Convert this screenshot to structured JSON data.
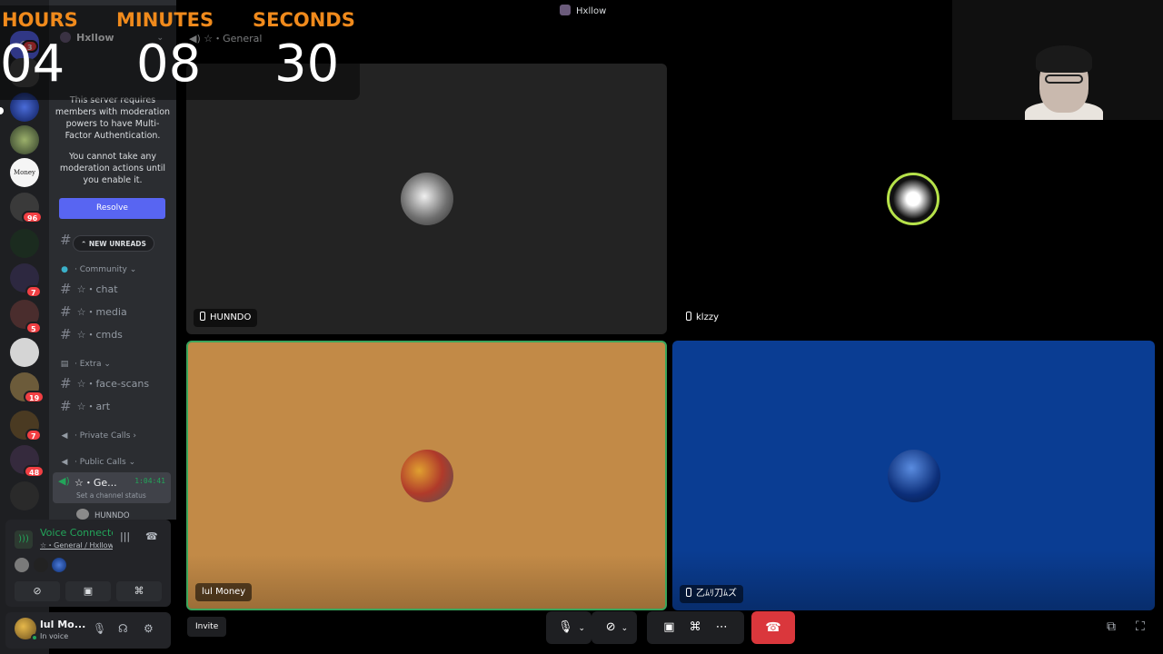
{
  "window": {
    "title": "Hxllow"
  },
  "timer": {
    "hours_label": "HOURS",
    "minutes_label": "MINUTES",
    "seconds_label": "SECONDS",
    "hours": "04",
    "minutes": "08",
    "seconds": "30"
  },
  "server": {
    "name": "Hxllow"
  },
  "rail": {
    "badges": [
      "3",
      "96",
      "7",
      "5",
      "19",
      "7",
      "48"
    ],
    "money_label": "Money"
  },
  "mfa_notice": {
    "line1": "This server requires members with moderation powers to have Multi-Factor Authentication.",
    "line2": "You cannot take any moderation actions until you enable it.",
    "button": "Resolve"
  },
  "new_unreads": "NEW UNREADS",
  "categories": {
    "community": "Community",
    "extra": "Extra",
    "private_calls": "Private Calls",
    "public_calls": "Public Calls"
  },
  "channels": {
    "chat": "☆・chat",
    "media": "☆・media",
    "cmds": "☆・cmds",
    "face_scans": "☆・face-scans",
    "art": "☆・art"
  },
  "active_voice": {
    "name": "☆・Ge...",
    "timer": "1:04:41",
    "status_placeholder": "Set a channel status",
    "member": "HUNNDO"
  },
  "voice_panel": {
    "status": "Voice Connected",
    "location": "☆・General / Hxllow"
  },
  "user": {
    "name": "lul Mo...",
    "status": "In voice"
  },
  "stage": {
    "channel_title": "☆・General",
    "invite": "Invite",
    "tiles": [
      {
        "name": "HUNNDO",
        "bg": "#232323"
      },
      {
        "name": "klzzy",
        "bg": "#000000"
      },
      {
        "name": "lul Money",
        "bg": "#c28a47"
      },
      {
        "name": "乙ﾑﾘ刀ﾑズ",
        "bg": "#0a3d93"
      }
    ]
  },
  "colors": {
    "accent": "#5865f2",
    "online": "#23a55a",
    "danger": "#da373c",
    "timer_label": "#f08a1c",
    "speaking_border": "#3ba55c"
  },
  "icons": [
    "discord-icon",
    "speaker-icon",
    "hash-icon",
    "signal-icon",
    "waveform-icon",
    "disconnect-icon",
    "camera-off-icon",
    "screen-share-icon",
    "activity-icon",
    "mic-icon",
    "headphones-icon",
    "gear-icon",
    "more-icon",
    "popout-icon",
    "fullscreen-icon",
    "phone-icon"
  ]
}
